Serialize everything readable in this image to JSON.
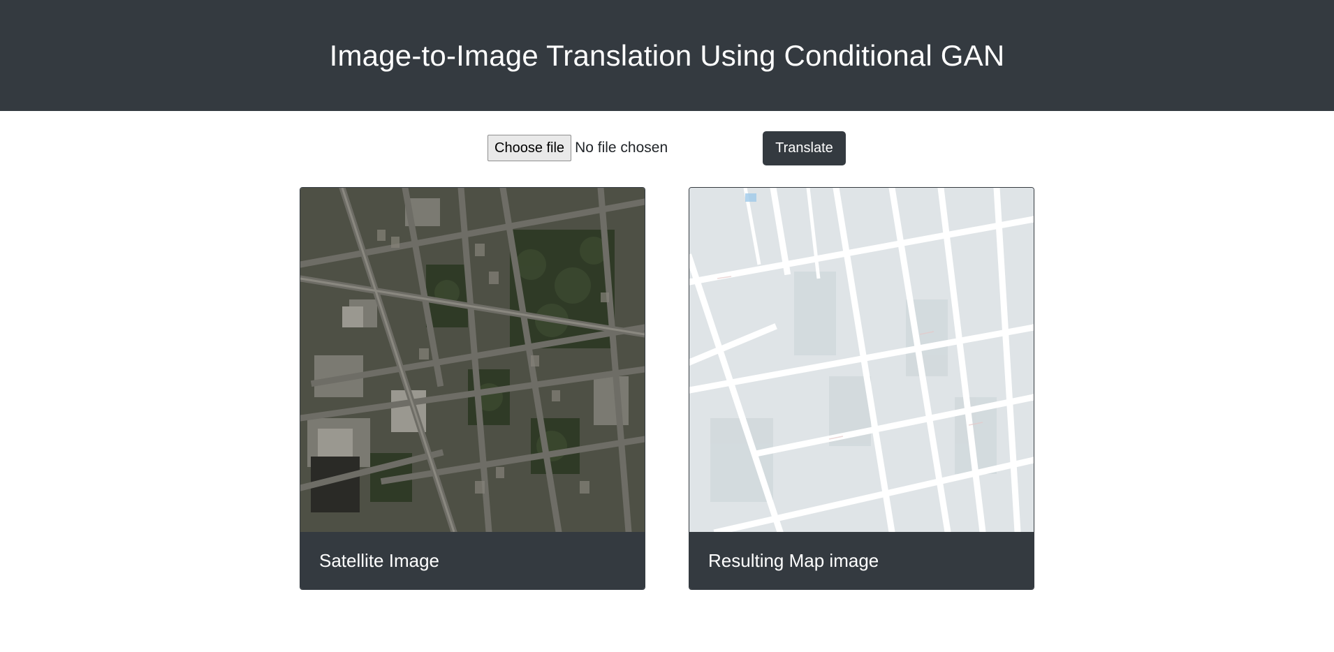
{
  "header": {
    "title": "Image-to-Image Translation Using Conditional GAN"
  },
  "upload": {
    "choose_label": "Choose file",
    "status_text": "No file chosen"
  },
  "actions": {
    "translate_label": "Translate"
  },
  "cards": {
    "input": {
      "caption": "Satellite Image",
      "image": "satellite-aerial-image"
    },
    "output": {
      "caption": "Resulting Map image",
      "image": "generated-map-image"
    }
  },
  "colors": {
    "header_bg": "#343a40",
    "button_bg": "#343a40",
    "text_light": "#ffffff"
  }
}
